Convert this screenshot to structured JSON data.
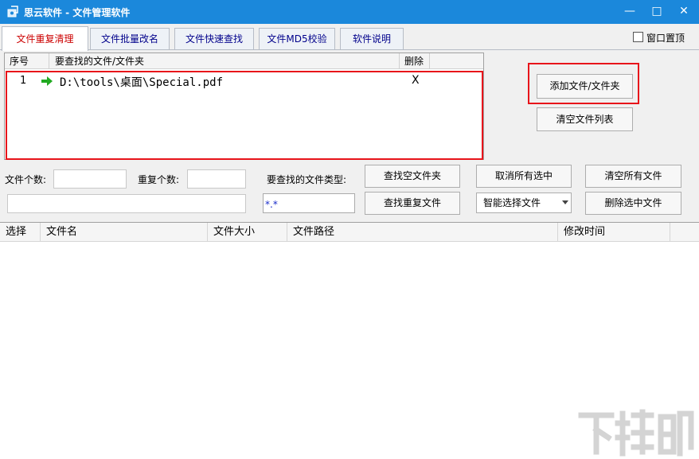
{
  "window": {
    "title": "思云软件 - 文件管理软件",
    "minimize": "—",
    "maximize": "□",
    "close": "✕"
  },
  "tabs": [
    {
      "label": "文件重复清理",
      "active": true
    },
    {
      "label": "文件批量改名",
      "active": false
    },
    {
      "label": "文件快速查找",
      "active": false
    },
    {
      "label": "文件MD5校验",
      "active": false
    },
    {
      "label": "软件说明",
      "active": false
    }
  ],
  "topmost": {
    "label": "窗口置顶",
    "checked": false
  },
  "folder_list": {
    "columns": [
      "序号",
      "要查找的文件/文件夹",
      "删除"
    ],
    "rows": [
      {
        "index": "1",
        "path": "D:\\tools\\桌面\\Special.pdf",
        "delete": "X"
      }
    ]
  },
  "buttons": {
    "add_file": "添加文件/文件夹",
    "clear_list": "清空文件列表",
    "find_empty": "查找空文件夹",
    "find_duplicate": "查找重复文件",
    "deselect_all": "取消所有选中",
    "clear_all": "清空所有文件",
    "delete_selected": "删除选中文件"
  },
  "stats": {
    "file_count_label": "文件个数:",
    "file_count_value": "",
    "dup_count_label": "重复个数:",
    "dup_count_value": "",
    "status_value": ""
  },
  "filetype": {
    "label": "要查找的文件类型:",
    "value": "*.*"
  },
  "smart_select": {
    "value": "智能选择文件"
  },
  "result_list": {
    "columns": [
      "选择",
      "文件名",
      "文件大小",
      "文件路径",
      "修改时间"
    ],
    "rows": []
  },
  "watermark": {
    "text": "下载吧"
  },
  "colors": {
    "titlebar": "#1b88db",
    "highlight_red": "#e8141a",
    "active_tab_text": "#cc0000",
    "tab_text": "#00008b",
    "arrow_green": "#22aa22"
  }
}
